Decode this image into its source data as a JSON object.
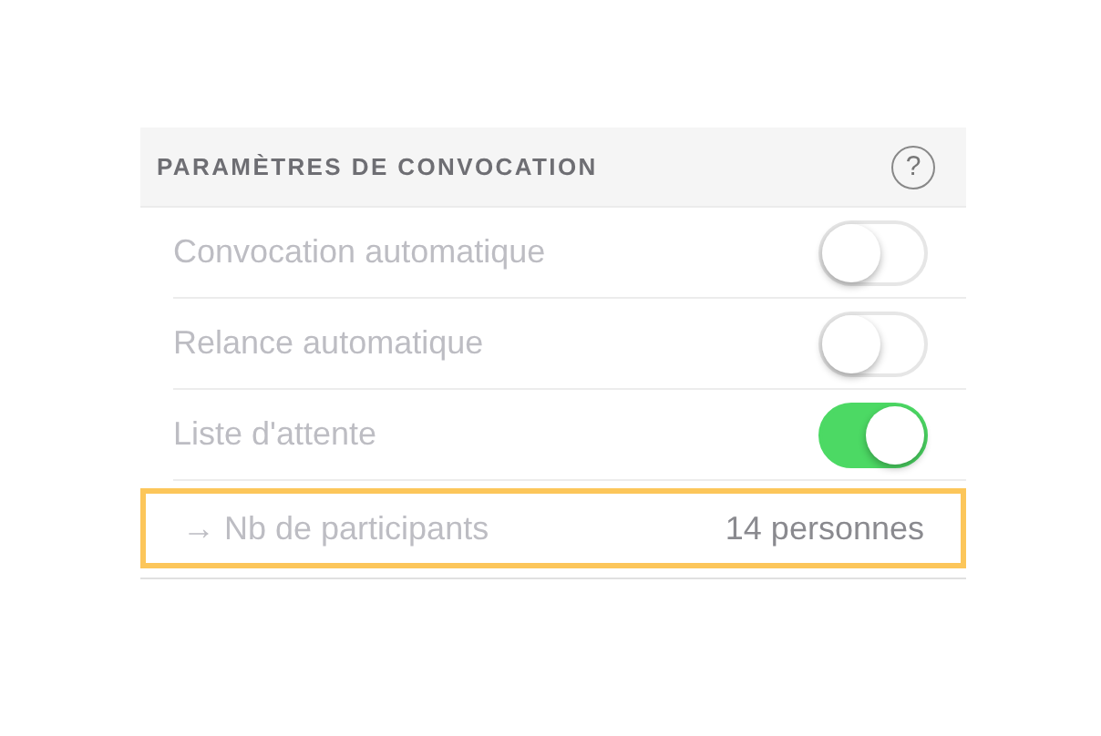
{
  "section": {
    "title": "PARAMÈTRES DE CONVOCATION",
    "help": "?"
  },
  "rows": [
    {
      "kind": "toggle",
      "label": "Convocation automatique",
      "on": false
    },
    {
      "kind": "toggle",
      "label": "Relance automatique",
      "on": false
    },
    {
      "kind": "toggle",
      "label": "Liste d'attente",
      "on": true
    },
    {
      "kind": "value",
      "label": "→ Nb de participants",
      "value": "14 personnes",
      "highlighted": true
    }
  ]
}
